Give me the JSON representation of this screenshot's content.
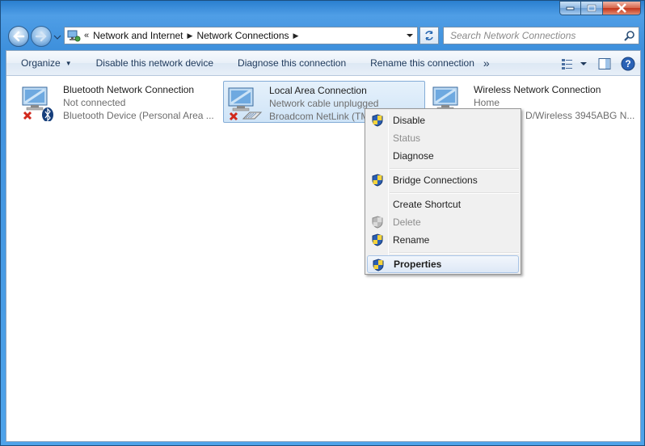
{
  "window": {
    "caption_buttons": [
      "minimize",
      "maximize",
      "close"
    ]
  },
  "nav": {
    "breadcrumb_chevrons": "«",
    "breadcrumbs": [
      "Network and Internet",
      "Network Connections"
    ],
    "search_placeholder": "Search Network Connections"
  },
  "toolbar": {
    "organize": "Organize",
    "disable": "Disable this network device",
    "diagnose": "Diagnose this connection",
    "rename": "Rename this connection",
    "more": "»"
  },
  "connections": [
    {
      "name": "Bluetooth Network Connection",
      "status": "Not connected",
      "device": "Bluetooth Device (Personal Area ..."
    },
    {
      "name": "Local Area Connection",
      "status": "Network cable unplugged",
      "device": "Broadcom NetLink (TM"
    },
    {
      "name": "Wireless Network Connection",
      "status": "Home",
      "device": "D/Wireless 3945ABG N..."
    }
  ],
  "context_menu": [
    {
      "label": "Disable",
      "shield": true,
      "disabled": false,
      "bold": false
    },
    {
      "label": "Status",
      "shield": false,
      "disabled": true,
      "bold": false
    },
    {
      "label": "Diagnose",
      "shield": false,
      "disabled": false,
      "bold": false
    },
    {
      "label": "Bridge Connections",
      "shield": true,
      "disabled": false,
      "bold": false
    },
    {
      "label": "Create Shortcut",
      "shield": false,
      "disabled": false,
      "bold": false
    },
    {
      "label": "Delete",
      "shield": true,
      "disabled": true,
      "bold": false
    },
    {
      "label": "Rename",
      "shield": true,
      "disabled": false,
      "bold": false
    },
    {
      "label": "Properties",
      "shield": true,
      "disabled": false,
      "bold": true
    }
  ],
  "colors": {
    "accent": "#3e90dc",
    "selection": "#cfe4f7",
    "error_red": "#d1281c"
  }
}
